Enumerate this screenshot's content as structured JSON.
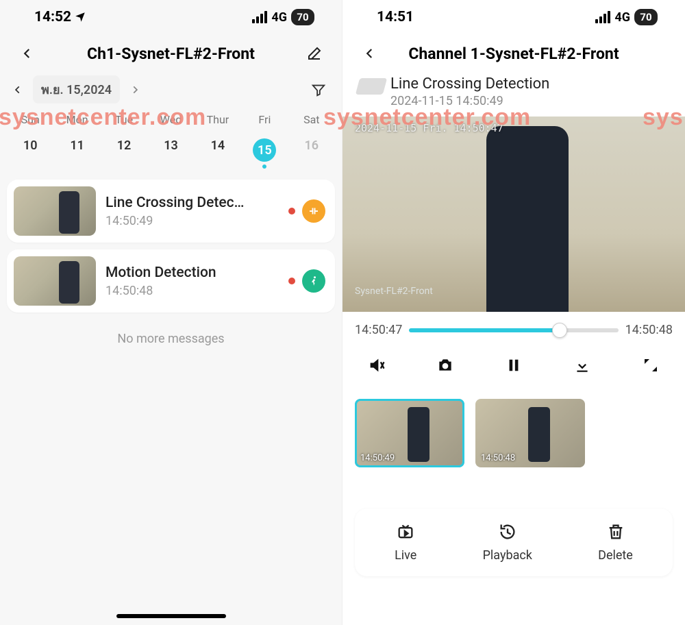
{
  "watermark": "sysnetcenter.com",
  "left": {
    "status": {
      "time": "14:52",
      "network": "4G",
      "battery": "70"
    },
    "title": "Ch1-Sysnet-FL#2-Front",
    "date_label": "พ.ย. 15,2024",
    "weekdays": [
      "Sun",
      "Mon",
      "Tue",
      "Wed",
      "Thur",
      "Fri",
      "Sat"
    ],
    "days": [
      {
        "n": "10"
      },
      {
        "n": "11"
      },
      {
        "n": "12"
      },
      {
        "n": "13"
      },
      {
        "n": "14"
      },
      {
        "n": "15",
        "selected": true,
        "dot": true
      },
      {
        "n": "16",
        "dim": true
      }
    ],
    "events": [
      {
        "title": "Line Crossing Detec…",
        "time": "14:50:49",
        "icon": "line-cross",
        "color": "orange"
      },
      {
        "title": "Motion Detection",
        "time": "14:50:48",
        "icon": "motion",
        "color": "green"
      }
    ],
    "no_more": "No more messages"
  },
  "right": {
    "status": {
      "time": "14:51",
      "network": "4G",
      "battery": "70"
    },
    "title": "Channel 1-Sysnet-FL#2-Front",
    "detection_title": "Line Crossing Detection",
    "detection_time": "2024-11-15 14:50:49",
    "video_overlay_ts": "2024-11-15 Fri. 14:50:47",
    "video_overlay_wm": "Sysnet-FL#2-Front",
    "scrubber": {
      "start": "14:50:47",
      "end": "14:50:48"
    },
    "clips": [
      {
        "time": "14:50:49",
        "active": true
      },
      {
        "time": "14:50:48",
        "active": false
      }
    ],
    "actions": {
      "live": "Live",
      "playback": "Playback",
      "delete": "Delete"
    }
  }
}
